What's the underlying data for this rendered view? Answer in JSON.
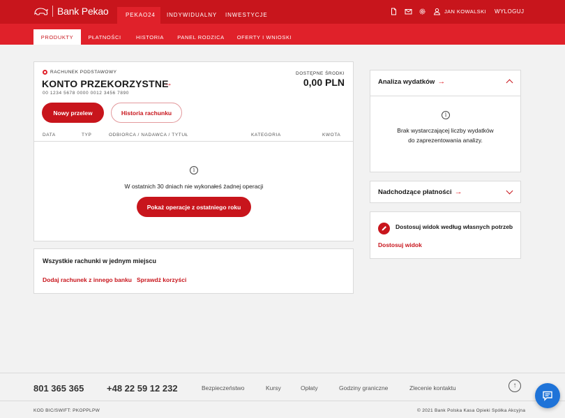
{
  "brand": {
    "name": "Bank Pekao"
  },
  "top_nav": {
    "tabs": [
      {
        "label": "PEKAO24"
      },
      {
        "label": "INDYWIDUALNY"
      },
      {
        "label": "INWESTYCJE"
      }
    ],
    "user_name": "JAN KOWALSKI",
    "logout_label": "WYLOGUJ"
  },
  "sub_nav": {
    "tabs": [
      {
        "label": "PRODUKTY"
      },
      {
        "label": "PŁATNOŚCI"
      },
      {
        "label": "HISTORIA"
      },
      {
        "label": "PANEL RODZICA"
      },
      {
        "label": "OFERTY I WNIOSKI"
      }
    ]
  },
  "account": {
    "type_label": "RACHUNEK PODSTAWOWY",
    "name": "KONTO PRZEKORZYSTNE",
    "number": "00 1234 5678 0000 0012 3456 7890",
    "available_label": "DOSTĘPNE ŚRODKI",
    "available_value": "0,00 PLN",
    "new_transfer_label": "Nowy przelew",
    "history_label": "Historia rachunku",
    "table_headers": [
      "DATA",
      "TYP",
      "ODBIORCA / NADAWCA / TYTUŁ",
      "KATEGORIA",
      "KWOTA"
    ],
    "empty_message": "W ostatnich 30 dniach nie wykonałeś żadnej operacji",
    "show_last_year_label": "Pokaż operacje z ostatniego roku"
  },
  "all_accounts": {
    "title": "Wszystkie rachunki w jednym miejscu",
    "add_external_label": "Dodaj rachunek z innego banku",
    "check_benefits_label": "Sprawdź korzyści"
  },
  "expenses": {
    "title": "Analiza wydatków",
    "message_line1": "Brak wystarczającej liczby wydatków",
    "message_line2": "do zaprezentowania analizy."
  },
  "upcoming": {
    "title": "Nadchodzące płatności"
  },
  "customize": {
    "title": "Dostosuj widok według własnych potrzeb",
    "link_label": "Dostosuj widok"
  },
  "footer": {
    "phone1": "801 365 365",
    "phone2": "+48 22 59 12 232",
    "links": [
      "Bezpieczeństwo",
      "Kursy",
      "Opłaty",
      "Godziny graniczne",
      "Zlecenie kontaktu"
    ],
    "bic": "KOD BIC/SWIFT: PKOPPLPW",
    "copyright": "© 2021 Bank Polska Kasa Opieki Spółka Akcyjna"
  },
  "colors": {
    "brand_red": "#c8151c",
    "nav_red": "#e0212a",
    "chat_blue": "#1e73d8"
  }
}
